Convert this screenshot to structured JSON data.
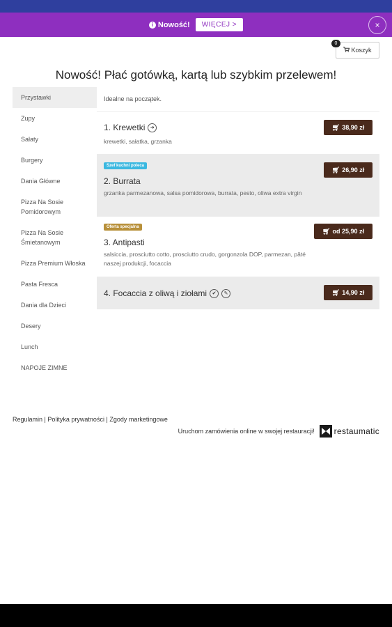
{
  "promo": {
    "text": "Nowość!",
    "info_glyph": "i",
    "more_label": "WIĘCEJ >",
    "close_label": "×",
    "color": "#8e2fbf"
  },
  "cart": {
    "label": "Koszyk",
    "count": "0",
    "icon": "cart-icon"
  },
  "headline": "Nowość! Płać gotówką, kartą lub szybkim przelewem!",
  "sidebar": {
    "items": [
      {
        "label": "Przystawki"
      },
      {
        "label": "Zupy"
      },
      {
        "label": "Sałaty"
      },
      {
        "label": "Burgery"
      },
      {
        "label": "Dania Główne"
      },
      {
        "label": "Pizza Na Sosie Pomidorowym"
      },
      {
        "label": "Pizza Na Sosie Śmietanowym"
      },
      {
        "label": "Pizza Premium Włoska"
      },
      {
        "label": "Pasta Fresca"
      },
      {
        "label": "Dania dla Dzieci"
      },
      {
        "label": "Desery"
      },
      {
        "label": "Lunch"
      },
      {
        "label": "NAPOJE ZIMNE"
      }
    ]
  },
  "main": {
    "intro": "Idealne na początek.",
    "items": [
      {
        "name": "1. Krewetki",
        "desc": "krewetki, sałatka, grzanka",
        "price": "38,90 zł",
        "icon": "spicy-icon"
      },
      {
        "tag": "Szef kuchni poleca",
        "name": "2. Burrata",
        "desc": "grzanka parmezanowa, salsa pomidorowa, burrata, pesto, oliwa extra virgin",
        "price": "26,90 zł",
        "tag_color": "#3bb8e0"
      },
      {
        "tag": "Oferta specjalna",
        "name": "3. Antipasti",
        "desc": "salsiccia, prosciutto cotto, prosciutto crudo, gorgonzola DOP, parmezan, pâté naszej produkcji, focaccia",
        "price": "od 25,90 zł",
        "tag_color": "#b8903a"
      },
      {
        "name": "4. Focaccia z oliwą i ziołami",
        "price": "14,90 zł",
        "icons": [
          "vegetarian-icon",
          "leaf-icon"
        ]
      }
    ],
    "price_color": "#4a2a1c"
  },
  "footer": {
    "link_regulamin": "Regulamin",
    "link_privacy": "Polityka prywatności",
    "link_consents": "Zgody marketingowe",
    "sep": "|",
    "cta": "Uruchom zamówienia online w swojej restauracji!",
    "brand": "restaumatic"
  }
}
